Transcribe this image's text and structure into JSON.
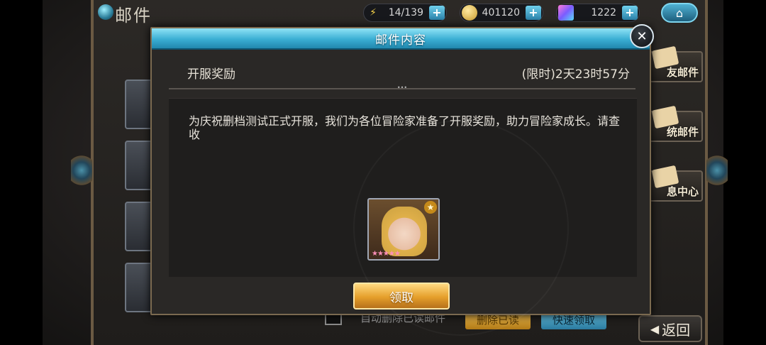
{
  "header": {
    "title": "邮件",
    "energy": "14/139",
    "gold": "401120",
    "gems": "1222"
  },
  "right_tabs": [
    {
      "label": "友邮件"
    },
    {
      "label": "统邮件"
    },
    {
      "label": "息中心"
    }
  ],
  "bottom": {
    "auto_delete": "自动删除已读邮件",
    "delete_read": "删除已读",
    "quick_claim": "快速领取",
    "back": "返回"
  },
  "modal": {
    "title": "邮件内容",
    "mail_title": "开服奖励",
    "timer": "(限时)2天23时57分",
    "body": "为庆祝删档测试正式开服，我们为各位冒险家准备了开服奖励，助力冒险家成长。请查收",
    "reward_stars": "★★★★★",
    "claim": "领取"
  },
  "icons": {
    "close": "close-icon",
    "home": "home-icon",
    "energy": "lightning-icon",
    "gold": "coin-icon",
    "gem": "crystal-icon"
  }
}
